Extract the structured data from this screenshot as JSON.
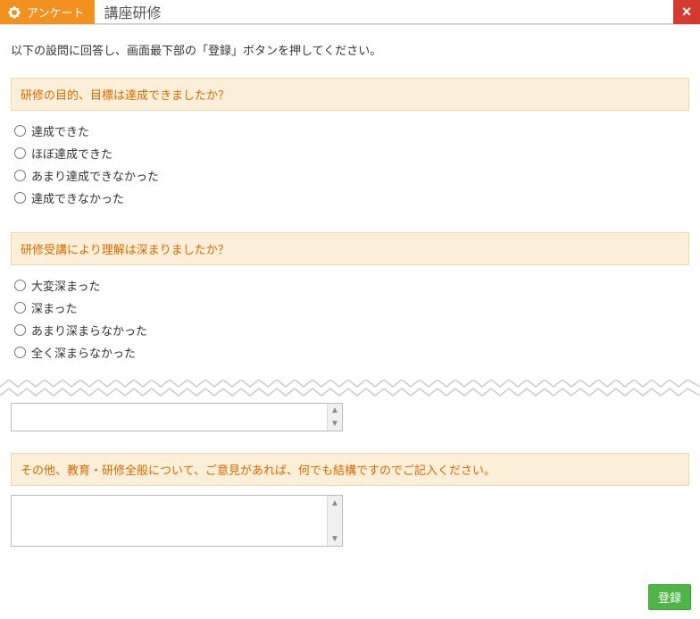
{
  "titlebar": {
    "tab_label": "アンケート",
    "page_title": "講座研修"
  },
  "instruction": "以下の設問に回答し、画面最下部の「登録」ボタンを押してください。",
  "questions": [
    {
      "prompt": "研修の目的、目標は達成できましたか？",
      "type": "radio",
      "options": [
        "達成できた",
        "ほぼ達成できた",
        "あまり達成できなかった",
        "達成できなかった"
      ]
    },
    {
      "prompt": "研修受講により理解は深まりましたか？",
      "type": "radio",
      "options": [
        "大変深まった",
        "深まった",
        "あまり深まらなかった",
        "全く深まらなかった"
      ]
    }
  ],
  "truncated_textarea": {
    "value": ""
  },
  "freeform": {
    "prompt": "その他、教育・研修全般について、ご意見があれば、何でも結構ですのでご記入ください。",
    "value": ""
  },
  "register_label": "登録"
}
